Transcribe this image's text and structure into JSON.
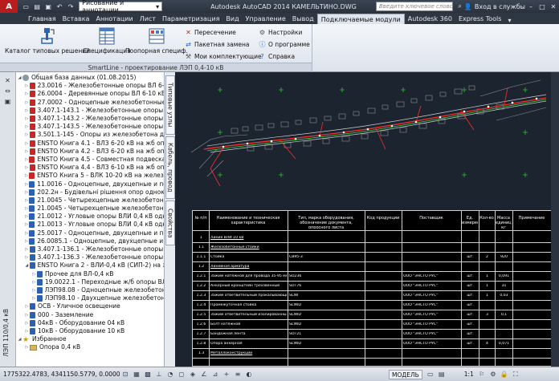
{
  "titlebar": {
    "app_logo": "A",
    "workspace": "Рисование и аннотации",
    "app_title": "Autodesk AutoCAD 2014   КАМЕЛЬТИНО.DWG",
    "search_placeholder": "Введите ключевое слово/фразу",
    "signin": "Вход в службы"
  },
  "tabs": [
    {
      "label": "Главная"
    },
    {
      "label": "Вставка"
    },
    {
      "label": "Аннотации"
    },
    {
      "label": "Лист"
    },
    {
      "label": "Параметризация"
    },
    {
      "label": "Вид"
    },
    {
      "label": "Управление"
    },
    {
      "label": "Вывод"
    },
    {
      "label": "Подключаемые модули"
    },
    {
      "label": "Autodesk 360"
    },
    {
      "label": "Express Tools"
    }
  ],
  "ribbon": {
    "catalog": "Каталог типовых решений",
    "spec": "Спецификация",
    "pole_spec": "Поопорная специф.",
    "intersection": "Пересечение",
    "batch": "Пакетная замена",
    "kits": "Мои комплектующие",
    "settings": "Настройки",
    "about": "О программе",
    "help": "Справка",
    "panel_title": "SmartLine - проектирование ЛЭП 0,4-10 кВ"
  },
  "palette": {
    "side_tabs": [
      "Типовые узлы",
      "Кабель, провод",
      "Свойства"
    ],
    "vertical_title": "ЛЭП 110/0,4 кВ"
  },
  "tree": [
    {
      "level": 0,
      "kind": "root",
      "label": "Общая база данных   (01.08.2015)"
    },
    {
      "level": 1,
      "kind": "red",
      "label": "23.0016 - Железобетонные опоры ВЛ 6-20"
    },
    {
      "level": 1,
      "kind": "red",
      "label": "26.0004 - Деревянные опоры ВЛ 6-10 кВ с"
    },
    {
      "level": 1,
      "kind": "red",
      "label": "27.0002 - Одноцепные железобетонные"
    },
    {
      "level": 1,
      "kind": "red",
      "label": "3.407.1-143.1 - Железобетонные опоры ВЛ"
    },
    {
      "level": 1,
      "kind": "red",
      "label": "3.407.1-143.2 - Железобетонные опоры ВЛ"
    },
    {
      "level": 1,
      "kind": "red",
      "label": "3.407.1-143.5 - Железобетонные опоры ВЛ"
    },
    {
      "level": 1,
      "kind": "red",
      "label": "3.501.1-145 - Опоры из железобетона для"
    },
    {
      "level": 1,
      "kind": "red",
      "label": "ENSTO Книга 4.1 - ВЛЗ 6-20 кВ на жб опор"
    },
    {
      "level": 1,
      "kind": "red",
      "label": "ENSTO Книга 4.2 - ВЛЗ 6-20 кВ на жб опор"
    },
    {
      "level": 1,
      "kind": "red",
      "label": "ENSTO Книга 4.5 - Совместная подвеска. П"
    },
    {
      "level": 1,
      "kind": "red",
      "label": "ENSTO Книга 4.4 - ВЛЗ 6-10 кВ на жб опор"
    },
    {
      "level": 1,
      "kind": "red",
      "label": "ENSTO Книга 5 - ВЛК 10-20 кВ на железобето"
    },
    {
      "level": 1,
      "kind": "blue",
      "label": "11.0016 - Одноцепные, двухцепные и перех"
    },
    {
      "level": 1,
      "kind": "blue",
      "label": "202.2н - Будівельні рішення опор одноколо"
    },
    {
      "level": 1,
      "kind": "blue",
      "label": "21.0045 - Четырехцепные железобетонные"
    },
    {
      "level": 1,
      "kind": "blue",
      "label": "21.0045 - Четырехцепные железобетонные"
    },
    {
      "level": 1,
      "kind": "blue",
      "label": "21.0012 - Угловые опоры ВЛИ 0,4 кВ одноц"
    },
    {
      "level": 1,
      "kind": "blue",
      "label": "21.0013 - Угловые опоры ВЛИ 0,4 кВ одноц"
    },
    {
      "level": 1,
      "kind": "blue",
      "label": "25.0017 - Одноцепные, двухцепные и пере"
    },
    {
      "level": 1,
      "kind": "blue",
      "label": "26.0085.1 - Одноцепные, двухцепные и пере"
    },
    {
      "level": 1,
      "kind": "blue",
      "label": "3.407.1-136.1 - Железобетонные опоры ВЛ"
    },
    {
      "level": 1,
      "kind": "blue",
      "label": "3.407.1-136.3 - Железобетонные опоры ВЛ"
    },
    {
      "level": 1,
      "kind": "blue",
      "label": "ENSTO Книга 2 - ВЛИ-0,4 кВ (СИП-2) на жб"
    },
    {
      "level": 2,
      "kind": "blue",
      "label": "Прочее для ВЛ-0,4 кВ"
    },
    {
      "level": 2,
      "kind": "blue",
      "label": "19.0022.1 - Переходные ж/б опоры ВЛ"
    },
    {
      "level": 2,
      "kind": "blue",
      "label": "ЛЭП98.08 - Одноцепные железобетонн"
    },
    {
      "level": 2,
      "kind": "blue",
      "label": "ЛЭП98.10 - Двухцепные железобетонн"
    },
    {
      "level": 1,
      "kind": "blue",
      "label": "ОСВ - Уличное освещение"
    },
    {
      "level": 1,
      "kind": "blue",
      "label": "000 - Заземление"
    },
    {
      "level": 1,
      "kind": "blue",
      "label": "04кВ - Оборудование 04 кВ"
    },
    {
      "level": 1,
      "kind": "blue",
      "label": "10кВ - Оборудование 10 кВ"
    },
    {
      "level": 0,
      "kind": "star",
      "label": "Избранное"
    },
    {
      "level": 1,
      "kind": "folder",
      "label": "Опора 0,4 кВ"
    }
  ],
  "sheet": {
    "headers": [
      "№ п/п",
      "Наименование и техническая характеристика",
      "Тип, марка оборудования, обозначение документа, опросного листа",
      "Код продукции",
      "Поставщик",
      "Ед. измерения",
      "Кол-во",
      "Масса единицы, кг",
      "Примечание"
    ],
    "rows": [
      {
        "n": "1",
        "name": "Линия ВЛИ 10 кВ",
        "type": "",
        "supplier": "",
        "unit": "",
        "qty": "",
        "mass": ""
      },
      {
        "n": "1.1",
        "name": "Железобетонные стойки",
        "type": "",
        "supplier": "",
        "unit": "",
        "qty": "",
        "mass": ""
      },
      {
        "n": "1.1.1",
        "name": "Стойка",
        "type": "СВ95-3",
        "supplier": "",
        "unit": "шт.",
        "qty": "2",
        "mass": "920"
      },
      {
        "n": "1.2",
        "name": "Линейная арматура",
        "type": "",
        "supplier": "",
        "unit": "",
        "qty": "",
        "mass": ""
      },
      {
        "n": "1.2.1",
        "name": "Зажим натяжной для провода 35-95 мм²",
        "type": "SO236",
        "supplier": "ООО \"ЭНСТО РУС\"",
        "unit": "шт.",
        "qty": "1",
        "mass": "0,091"
      },
      {
        "n": "1.2.2",
        "name": "Анкерный кронштейн трехзвенный",
        "type": "SOT76",
        "supplier": "ООО \"ЭНСТО РУС\"",
        "unit": "шт.",
        "qty": "1",
        "mass": "31"
      },
      {
        "n": "1.2.3",
        "name": "Зажим ответвительный прокалывающий",
        "type": "SLIW",
        "supplier": "ООО \"ЭНСТО РУС\"",
        "unit": "шт.",
        "qty": "1",
        "mass": "0,03"
      },
      {
        "n": "1.2.4",
        "name": "Промежуточная стойка",
        "type": "SLIWD",
        "supplier": "ООО \"ЭНСТО РУС\"",
        "unit": "шт.",
        "qty": "",
        "mass": ""
      },
      {
        "n": "1.2.5",
        "name": "Зажим ответвительный изолированный",
        "type": "SLIWD",
        "supplier": "ООО \"ЭНСТО РУС\"",
        "unit": "шт.",
        "qty": "3",
        "mass": "0,1"
      },
      {
        "n": "1.2.6",
        "name": "Болт натяжной",
        "type": "SLIWD",
        "supplier": "ООО \"ЭНСТО РУС\"",
        "unit": "шт.",
        "qty": "",
        "mass": ""
      },
      {
        "n": "1.2.7",
        "name": "Бандажная лента",
        "type": "SOT21",
        "supplier": "ООО \"ЭНСТО РУС\"",
        "unit": "шт.",
        "qty": "",
        "mass": ""
      },
      {
        "n": "1.2.8",
        "name": "Опора анкерная",
        "type": "SLIWD",
        "supplier": "ООО \"ЭНСТО РУС\"",
        "unit": "шт.",
        "qty": "4",
        "mass": "0,071"
      },
      {
        "n": "1.3",
        "name": "Металлоконструкции",
        "type": "",
        "supplier": "",
        "unit": "",
        "qty": "",
        "mass": ""
      },
      {
        "n": "1.3.1",
        "name": "Оголовок",
        "type": "",
        "supplier": "",
        "unit": "шт.",
        "qty": "2",
        "mass": "1,3"
      }
    ]
  },
  "status": {
    "coords": "1775322.4783, 4341150.5779, 0.0000",
    "model": "МОДЕЛЬ",
    "scale": "1:1"
  }
}
